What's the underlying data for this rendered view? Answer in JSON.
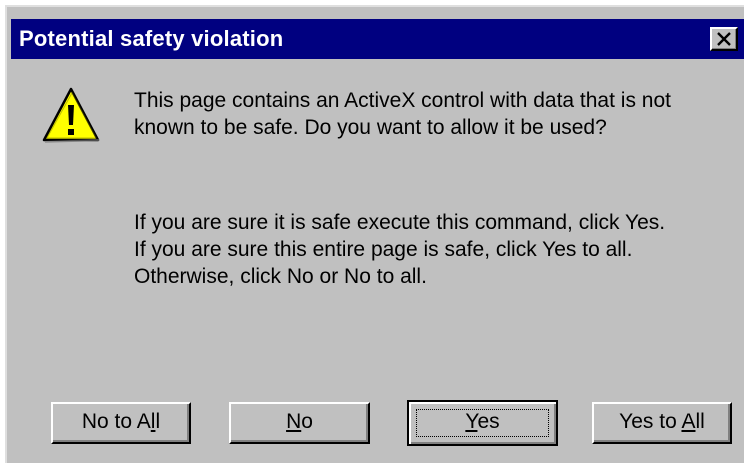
{
  "window": {
    "title": "Potential safety violation",
    "close_symbol": "×"
  },
  "icons": {
    "warning": "warning-icon",
    "close": "close-icon"
  },
  "message": {
    "line1": "This page contains an ActiveX control with data that is not",
    "line2": "known to be safe. Do you want to allow it be used?"
  },
  "detail": {
    "line1": "If you are sure it is safe execute this command, click Yes.",
    "line2": "If you are sure this entire page is safe, click Yes to all.",
    "line3": "Otherwise, click No or No to all."
  },
  "buttons": {
    "no_to_all": {
      "pre": "No to A",
      "mnemonic": "l",
      "post": "l"
    },
    "no": {
      "pre": "",
      "mnemonic": "N",
      "post": "o"
    },
    "yes": {
      "pre": "",
      "mnemonic": "Y",
      "post": "es"
    },
    "yes_to_all": {
      "pre": "Yes to ",
      "mnemonic": "A",
      "post": "ll"
    }
  },
  "colors": {
    "titlebar": "#000080",
    "face": "#c0c0c0",
    "warning_fill": "#ffff00"
  }
}
